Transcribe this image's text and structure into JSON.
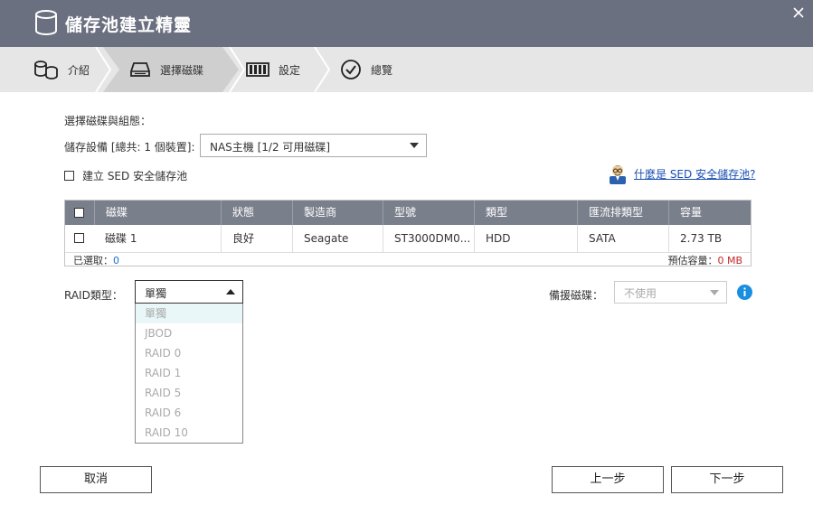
{
  "window": {
    "title": "儲存池建立精靈"
  },
  "steps": [
    {
      "label": "介紹",
      "icon": "intro-icon"
    },
    {
      "label": "選擇磁碟",
      "icon": "disk-icon",
      "active": true
    },
    {
      "label": "設定",
      "icon": "settings-icon"
    },
    {
      "label": "總覽",
      "icon": "checkmark-icon"
    }
  ],
  "content": {
    "section_title": "選擇磁碟與組態：",
    "device_label": "儲存設備 [總共: 1 個裝置]:",
    "device_value": "NAS主機 [1/2 可用磁碟]",
    "sed_label": "建立 SED 安全儲存池",
    "sed_help_link": "什麼是 SED 安全儲存池?"
  },
  "table": {
    "headers": [
      "磁碟",
      "狀態",
      "製造商",
      "型號",
      "類型",
      "匯流排類型",
      "容量"
    ],
    "rows": [
      [
        "磁碟 1",
        "良好",
        "Seagate",
        "ST3000DM0...",
        "HDD",
        "SATA",
        "2.73 TB"
      ]
    ],
    "footer": {
      "selected_label": "已選取：",
      "selected_value": "0",
      "capacity_label": "預估容量：",
      "capacity_value": "0 MB"
    }
  },
  "raid": {
    "label": "RAID類型：",
    "selected": "單獨",
    "options": [
      "單獨",
      "JBOD",
      "RAID 0",
      "RAID 1",
      "RAID 5",
      "RAID 6",
      "RAID 10"
    ]
  },
  "spare": {
    "label": "備援磁碟：",
    "value": "不使用"
  },
  "buttons": {
    "cancel": "取消",
    "prev": "上一步",
    "next": "下一步"
  },
  "colors": {
    "titlebar": "#6b7080",
    "table_header": "#7a7f8c",
    "link": "#1a4fb3",
    "info": "#1a8fe0",
    "capacity": "#c62828"
  }
}
